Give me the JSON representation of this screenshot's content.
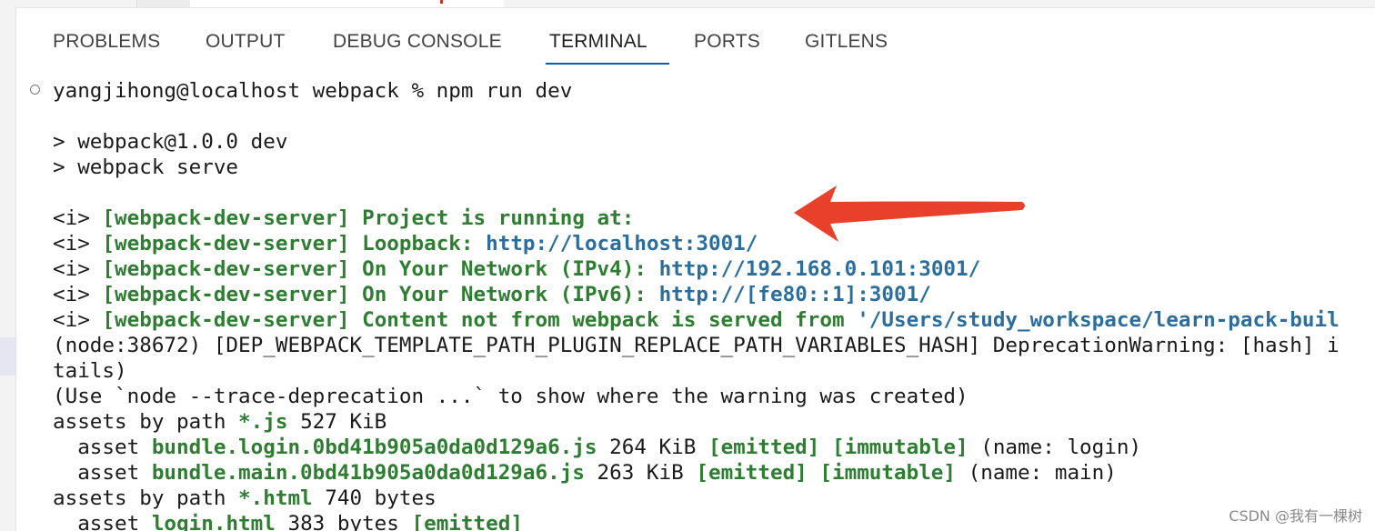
{
  "tabs": [
    {
      "label": "PROBLEMS"
    },
    {
      "label": "OUTPUT"
    },
    {
      "label": "DEBUG CONSOLE"
    },
    {
      "label": "TERMINAL"
    },
    {
      "label": "PORTS"
    },
    {
      "label": "GITLENS"
    }
  ],
  "terminal": {
    "prompt": "yangjihong@localhost webpack % npm run dev",
    "script1": "> webpack@1.0.0 dev",
    "script2": "> webpack serve",
    "info_prefix": "<i> ",
    "server_tag": "[webpack-dev-server]",
    "l1_msg": " Project is running at:",
    "l2_msg": " Loopback: ",
    "l2_url": "http://localhost:3001/",
    "l3_msg": " On Your Network (IPv4): ",
    "l3_url": "http://192.168.0.101:3001/",
    "l4_msg": " On Your Network (IPv6): ",
    "l4_url": "http://[fe80::1]:3001/",
    "l5_msg": " Content not from webpack is served from ",
    "l5_path": "'/Users/study_workspace/learn-pack-buil",
    "dep1": "(node:38672) [DEP_WEBPACK_TEMPLATE_PATH_PLUGIN_REPLACE_PATH_VARIABLES_HASH] DeprecationWarning: [hash] i",
    "dep2": "tails)",
    "dep3": "(Use `node --trace-deprecation ...` to show where the warning was created)",
    "js_group_prefix": "assets by path ",
    "js_group_pattern": "*.js",
    "js_group_size": " 527 KiB",
    "a1_prefix": "  asset ",
    "a1_name": "bundle.login.0bd41b905a0da0d129a6.js",
    "a1_size": " 264 KiB ",
    "a1_tags": "[emitted] [immutable]",
    "a1_suffix": " (name: login)",
    "a2_prefix": "  asset ",
    "a2_name": "bundle.main.0bd41b905a0da0d129a6.js",
    "a2_size": " 263 KiB ",
    "a2_tags": "[emitted] [immutable]",
    "a2_suffix": " (name: main)",
    "html_group_prefix": "assets by path ",
    "html_group_pattern": "*.html",
    "html_group_size": " 740 bytes",
    "a3_prefix": "  asset ",
    "a3_name": "login.html",
    "a3_size": " 383 bytes ",
    "a3_tags": "[emitted]"
  },
  "colors": {
    "accent": "#005fb8",
    "success": "#2e7d32",
    "link": "#2b6e9c",
    "arrow": "#e8402a"
  },
  "watermark": "CSDN @我有一棵树"
}
